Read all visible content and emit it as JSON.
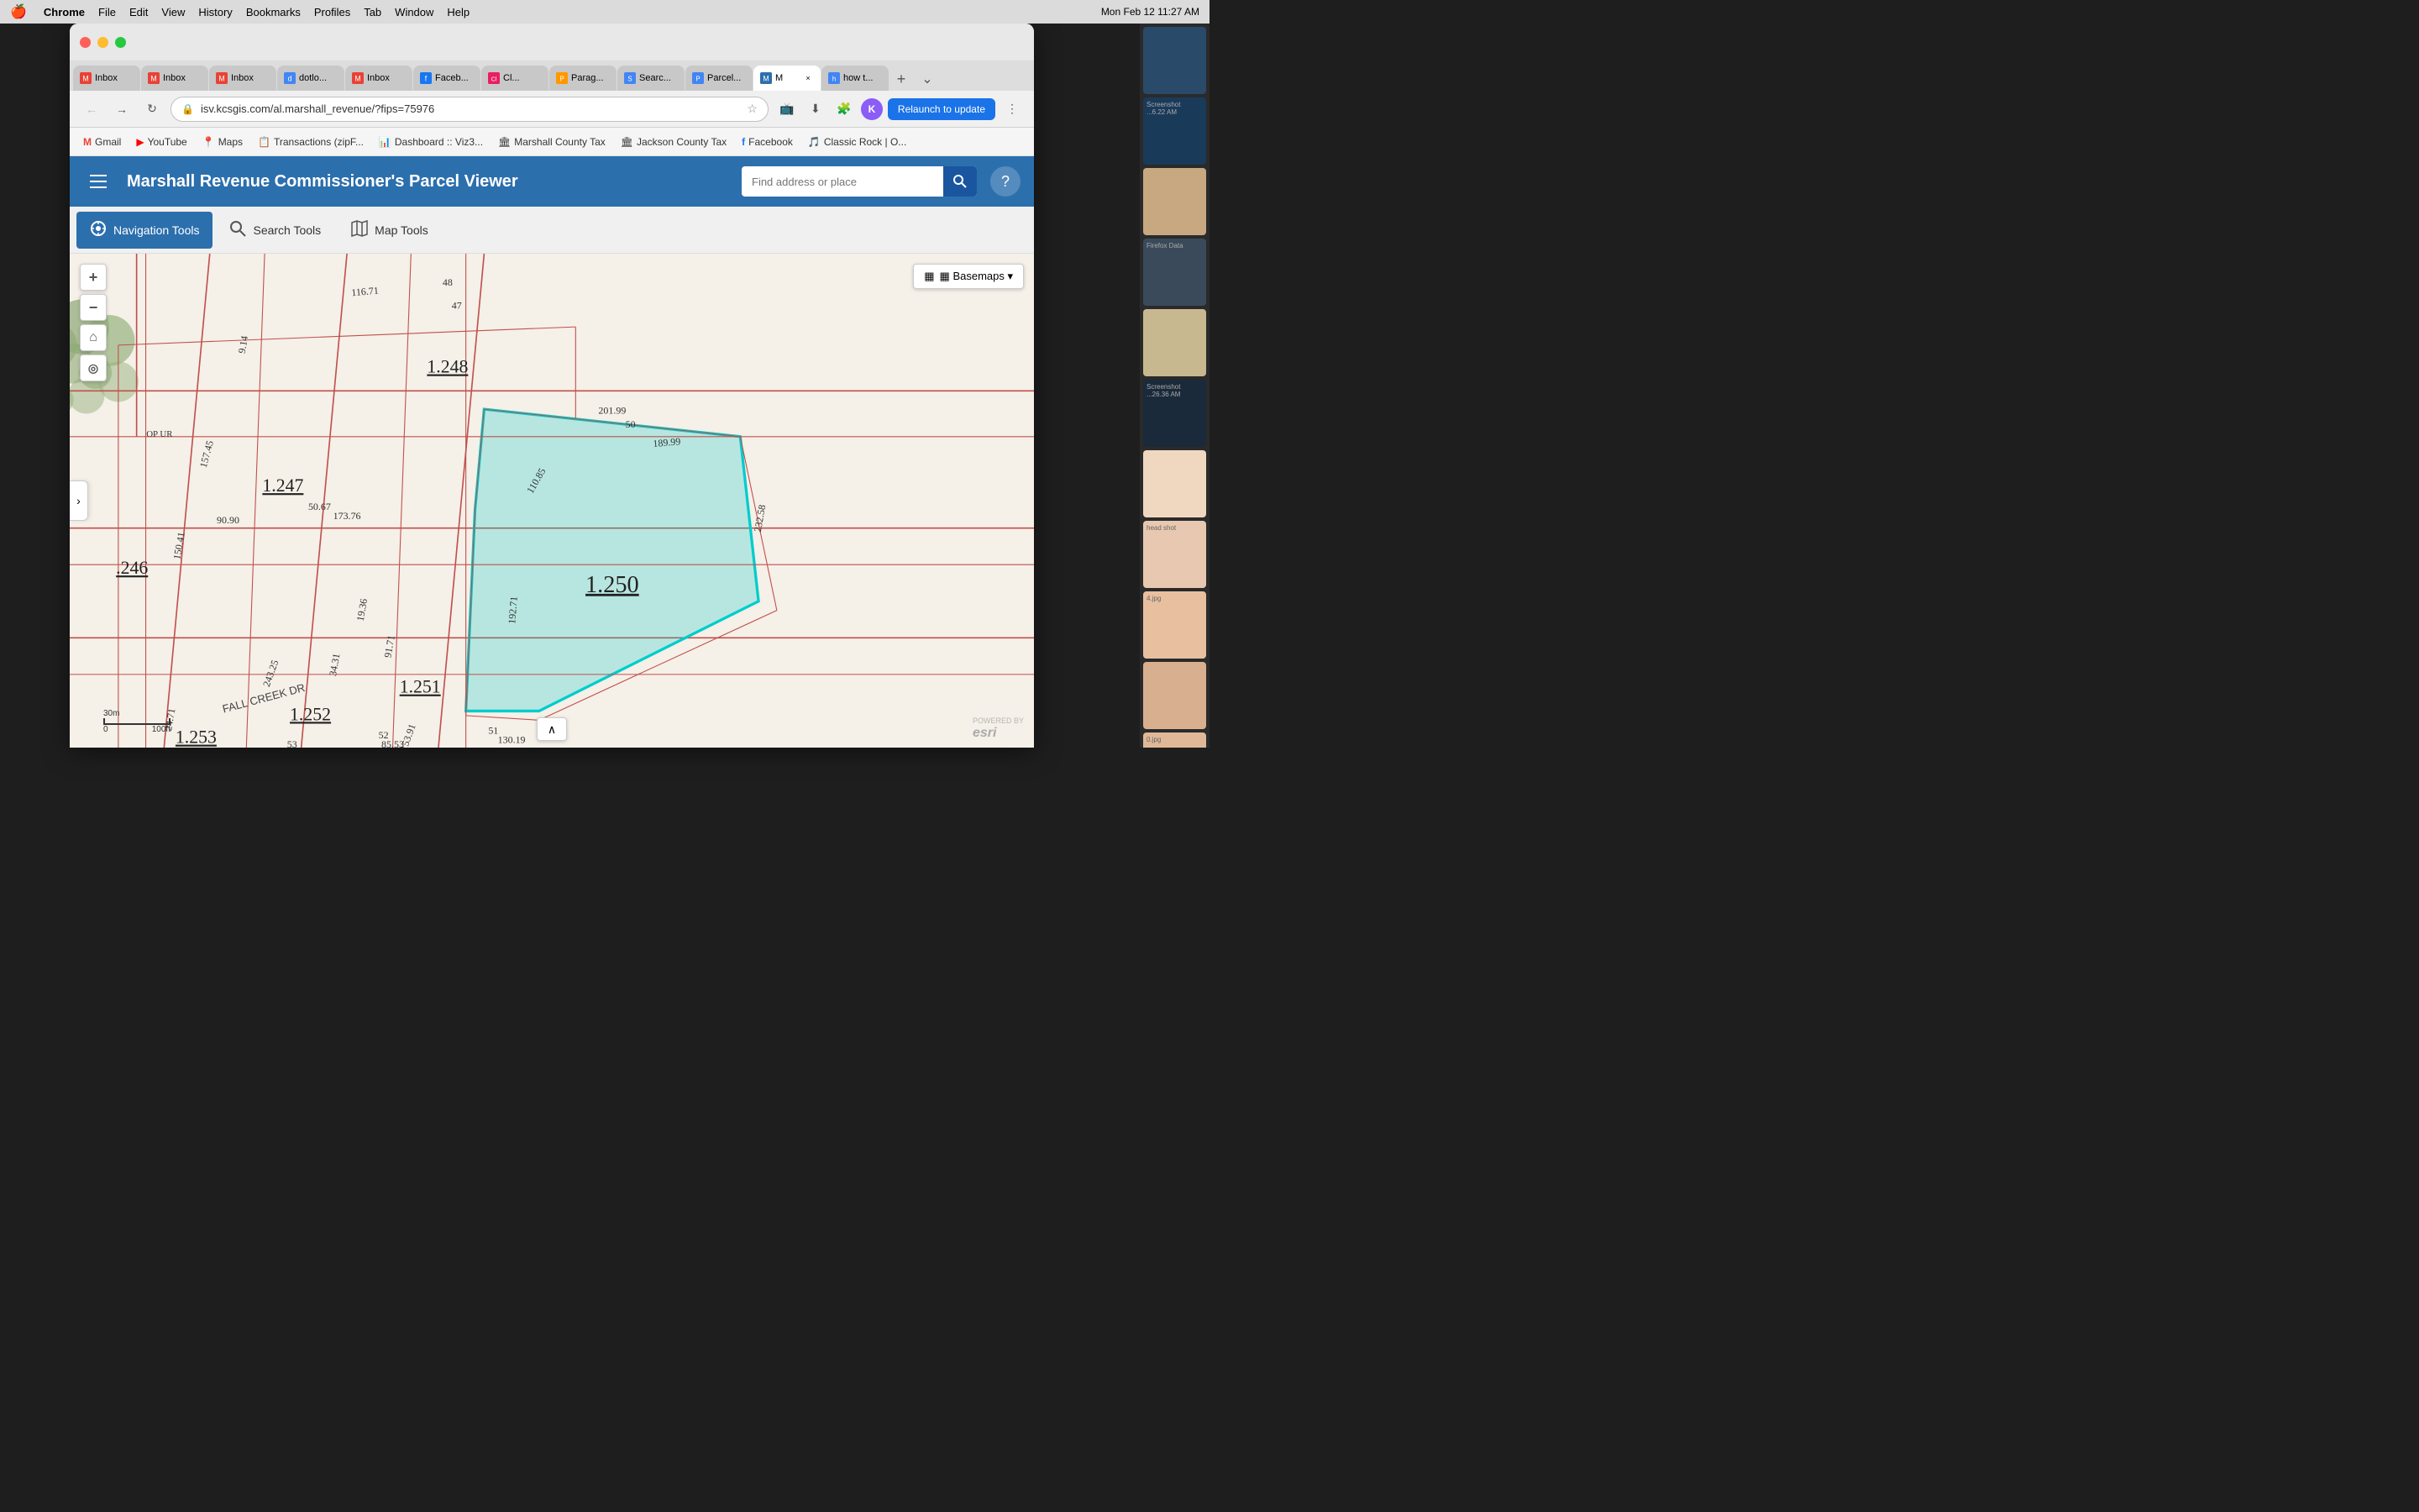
{
  "menubar": {
    "apple": "🍎",
    "items": [
      "Chrome",
      "File",
      "Edit",
      "View",
      "History",
      "Bookmarks",
      "Profiles",
      "Tab",
      "Window",
      "Help"
    ],
    "right": {
      "datetime": "Mon Feb 12  11:27 AM"
    }
  },
  "tabs": [
    {
      "id": "inbox1",
      "label": "Inbox",
      "favicon_color": "#e94235",
      "active": false
    },
    {
      "id": "inbox2",
      "label": "Inbox",
      "favicon_color": "#e94235",
      "active": false
    },
    {
      "id": "inbox3",
      "label": "Inbox",
      "favicon_color": "#e94235",
      "active": false
    },
    {
      "id": "dotloc",
      "label": "dotlo...",
      "favicon_color": "#4285f4",
      "active": false
    },
    {
      "id": "inbox4",
      "label": "Inbox",
      "favicon_color": "#e94235",
      "active": false
    },
    {
      "id": "faceb",
      "label": "Faceb...",
      "favicon_color": "#1877f2",
      "active": false
    },
    {
      "id": "cl",
      "label": "Cl...",
      "favicon_color": "#e91e63",
      "active": false
    },
    {
      "id": "parag",
      "label": "Parag...",
      "favicon_color": "#ff9800",
      "active": false
    },
    {
      "id": "searc",
      "label": "Searc...",
      "favicon_color": "#4285f4",
      "active": false
    },
    {
      "id": "parcel",
      "label": "Parcel...",
      "favicon_color": "#4285f4",
      "active": false
    },
    {
      "id": "m",
      "label": "M",
      "favicon_color": "#2c6fad",
      "active": true,
      "close": "×"
    },
    {
      "id": "howto",
      "label": "how t...",
      "favicon_color": "#4285f4",
      "active": false
    }
  ],
  "omnibar": {
    "back_title": "Back",
    "forward_title": "Forward",
    "reload_title": "Reload",
    "url": "isv.kcsgis.com/al.marshall_revenue/?fips=75976",
    "relaunch_label": "Relaunch to update",
    "new_tab_label": "+"
  },
  "bookmarks": [
    {
      "id": "gmail",
      "label": "Gmail",
      "icon": "✉"
    },
    {
      "id": "youtube",
      "label": "YouTube",
      "icon": "▶"
    },
    {
      "id": "maps",
      "label": "Maps",
      "icon": "📍"
    },
    {
      "id": "transactions",
      "label": "Transactions (zipF...",
      "icon": "📋"
    },
    {
      "id": "dashboard",
      "label": "Dashboard :: Viz3...",
      "icon": "📊"
    },
    {
      "id": "marshall",
      "label": "Marshall County Tax",
      "icon": "🏛"
    },
    {
      "id": "jackson",
      "label": "Jackson County Tax",
      "icon": "🏛"
    },
    {
      "id": "facebook",
      "label": "Facebook",
      "icon": "f"
    },
    {
      "id": "classic",
      "label": "Classic Rock | O...",
      "icon": "🎵"
    }
  ],
  "app": {
    "title": "Marshall Revenue Commissioner's Parcel Viewer",
    "search_placeholder": "Find address or place",
    "search_btn_label": "🔍",
    "help_btn_label": "?"
  },
  "toolbar": {
    "navigation_tools_label": "Navigation Tools",
    "search_tools_label": "Search Tools",
    "map_tools_label": "Map Tools"
  },
  "map_controls": {
    "zoom_in": "+",
    "zoom_out": "−",
    "home": "⌂",
    "locate": "◎",
    "basemaps_label": "▦ Basemaps ▾",
    "collapse_icon": "›"
  },
  "scale": {
    "metric": "30m",
    "imperial": "100ft"
  },
  "parcels": [
    {
      "id": "1.248",
      "label": "1.248"
    },
    {
      "id": "1.247",
      "label": "1.247"
    },
    {
      "id": "1.246",
      "label": ".246"
    },
    {
      "id": "1.250",
      "label": "1.250",
      "selected": true
    },
    {
      "id": "1.251",
      "label": "1.251"
    },
    {
      "id": "1.252",
      "label": "1.252"
    },
    {
      "id": "1.253",
      "label": "1.253"
    }
  ],
  "street_label": "FALL CREEK DR",
  "esri_label": "POWERED BY esri"
}
